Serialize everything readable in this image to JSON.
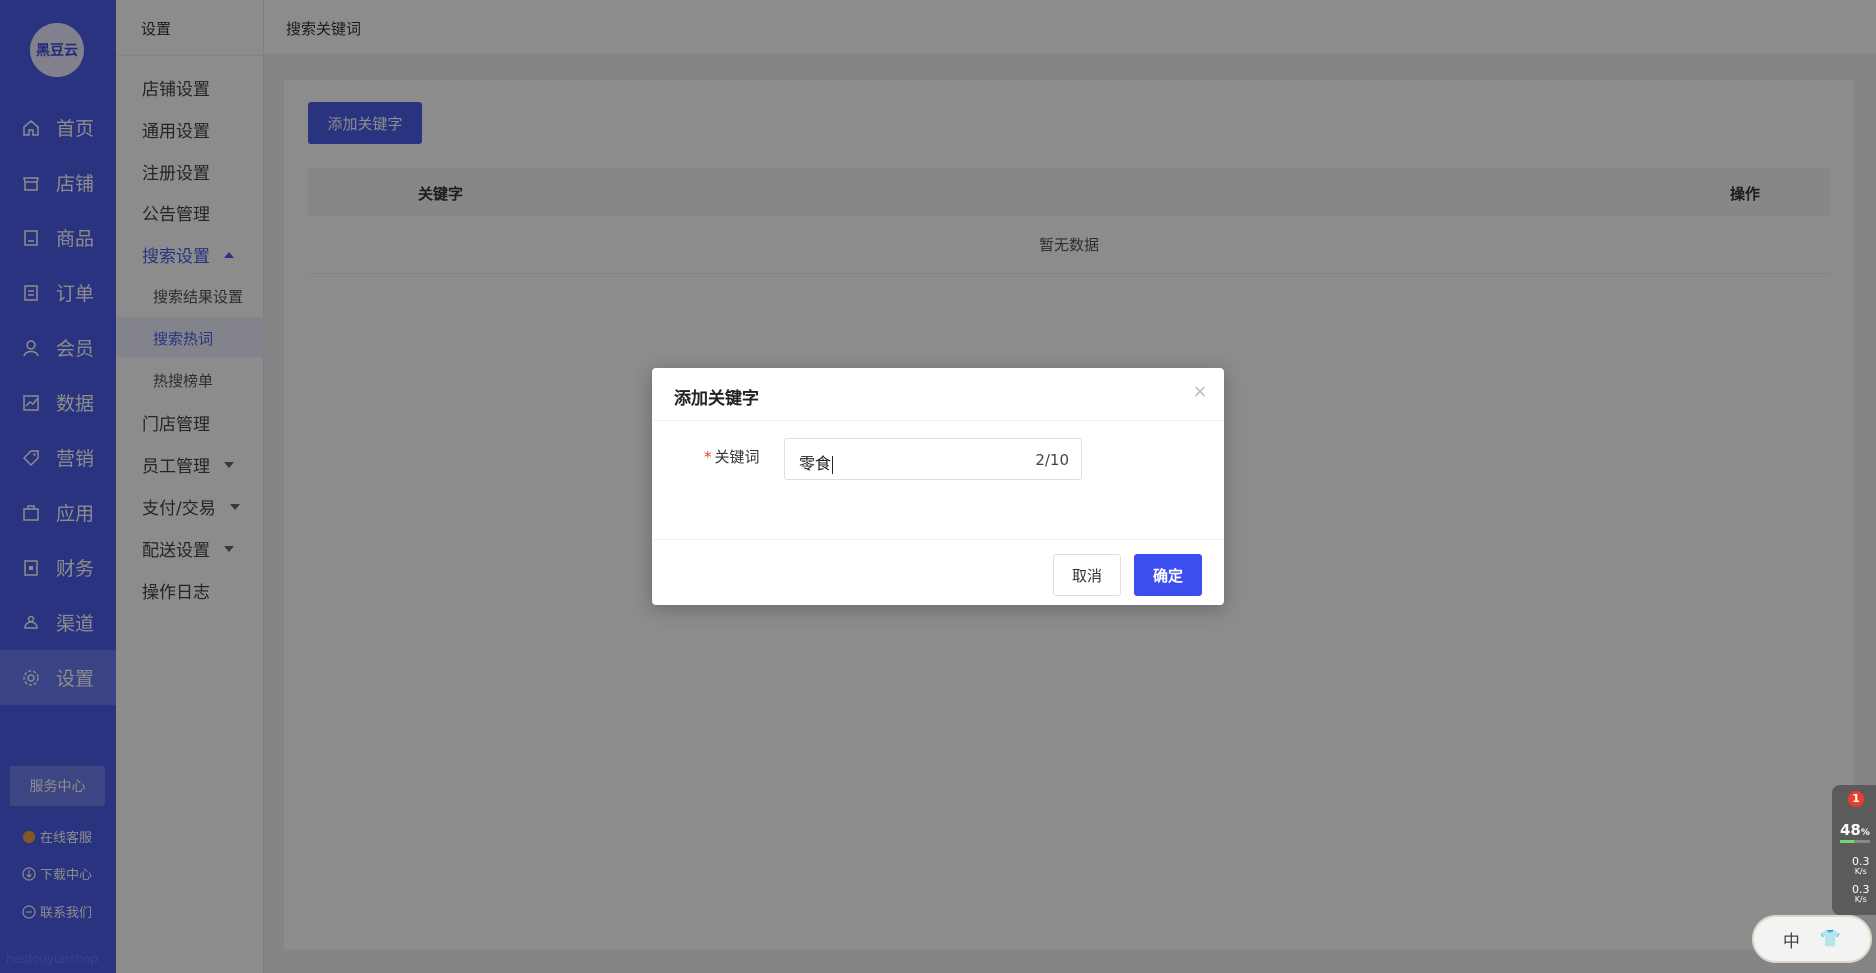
{
  "sidebar": {
    "logo": "黑豆云",
    "items": [
      {
        "label": "首页",
        "icon": "home-icon"
      },
      {
        "label": "店铺",
        "icon": "store-icon"
      },
      {
        "label": "商品",
        "icon": "product-icon"
      },
      {
        "label": "订单",
        "icon": "order-icon"
      },
      {
        "label": "会员",
        "icon": "member-icon"
      },
      {
        "label": "数据",
        "icon": "chart-icon"
      },
      {
        "label": "营销",
        "icon": "tag-icon"
      },
      {
        "label": "应用",
        "icon": "app-icon"
      },
      {
        "label": "财务",
        "icon": "finance-icon"
      },
      {
        "label": "渠道",
        "icon": "channel-icon"
      },
      {
        "label": "设置",
        "icon": "gear-icon"
      }
    ],
    "active": "设置",
    "service_center": "服务中心",
    "links": [
      "在线客服",
      "下载中心",
      "联系我们"
    ],
    "footer_text": "heidouyunshop"
  },
  "subnav": {
    "title": "设置",
    "items": [
      {
        "label": "店铺设置"
      },
      {
        "label": "通用设置"
      },
      {
        "label": "注册设置"
      },
      {
        "label": "公告管理"
      },
      {
        "label": "搜索设置"
      },
      {
        "label": "门店管理"
      },
      {
        "label": "员工管理"
      },
      {
        "label": "支付/交易"
      },
      {
        "label": "配送设置"
      },
      {
        "label": "操作日志"
      }
    ],
    "search_children": [
      "搜索结果设置",
      "搜索热词",
      "热搜榜单"
    ],
    "active_child": "搜索热词"
  },
  "header": {
    "breadcrumb": "搜索关键词"
  },
  "main": {
    "add_button": "添加关键字",
    "columns": [
      "关键字",
      "操作"
    ],
    "empty_text": "暂无数据"
  },
  "dialog": {
    "title": "添加关键字",
    "field_label": "关键词",
    "field_value": "零食",
    "char_count": "2/10",
    "cancel_label": "取消",
    "ok_label": "确定"
  },
  "monitor": {
    "badge": "1",
    "cpu_percent": "48",
    "cpu_unit": "%",
    "cpu_level": 0.48,
    "upload": "0.3",
    "download": "0.3",
    "speed_unit": "K/s"
  },
  "ime": {
    "mode": "中"
  },
  "colors": {
    "primary": "#4c5ee8",
    "ok_button": "#3c4ef0",
    "required": "#e53935"
  }
}
